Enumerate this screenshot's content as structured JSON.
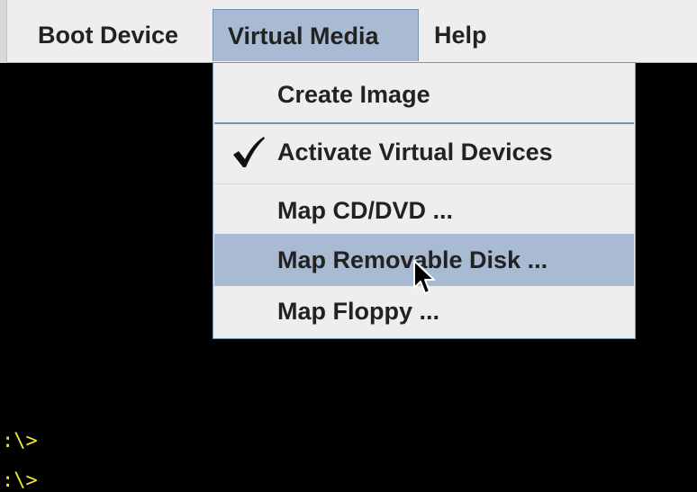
{
  "menubar": {
    "items": [
      {
        "label": "Boot Device"
      },
      {
        "label": "Virtual Media",
        "active": true
      },
      {
        "label": "Help"
      }
    ]
  },
  "virtual_media_menu": {
    "items": [
      {
        "label": "Create Image",
        "checked": false
      },
      {
        "label": "Activate Virtual Devices",
        "checked": true,
        "icon": "checkmark-icon"
      },
      {
        "label": "Map CD/DVD ...",
        "checked": false
      },
      {
        "label": "Map Removable Disk ...",
        "checked": false,
        "highlighted": true
      },
      {
        "label": "Map Floppy ...",
        "checked": false
      }
    ]
  },
  "terminal": {
    "lines": [
      ":\\>",
      ":\\>"
    ]
  },
  "colors": {
    "menubar_bg": "#eeeeee",
    "highlight": "#a8bbd3",
    "menu_border": "#7b91b2",
    "terminal_bg": "#000000",
    "terminal_text": "#f3e23a"
  }
}
